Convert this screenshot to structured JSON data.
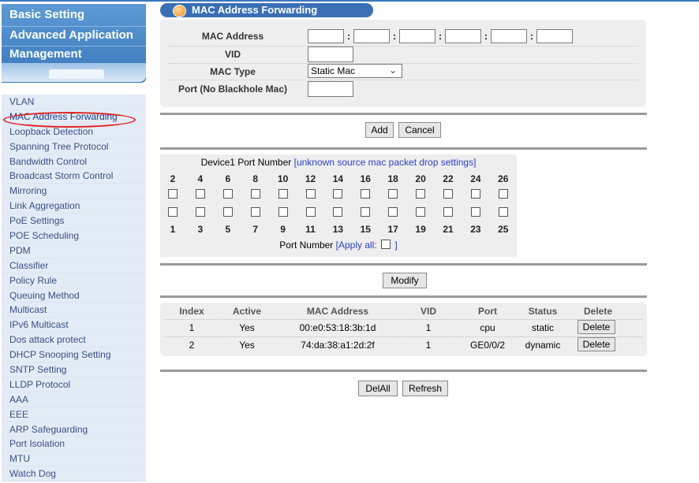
{
  "top_menu": [
    "Basic Setting",
    "Advanced Application",
    "Management"
  ],
  "nav_items": [
    "VLAN",
    "MAC Address Forwarding",
    "Loopback Detection",
    "Spanning Tree Protocol",
    "Bandwidth Control",
    "Broadcast Storm Control",
    "Mirroring",
    "Link Aggregation",
    "PoE Settings",
    "POE Scheduling",
    "PDM",
    "Classifier",
    "Policy Rule",
    "Queuing Method",
    "Multicast",
    "IPv6 Multicast",
    "Dos attack protect",
    "DHCP Snooping Setting",
    "SNTP Setting",
    "LLDP Protocol",
    "AAA",
    "EEE",
    "ARP Safeguarding",
    "Port Isolation",
    "MTU",
    "Watch Dog"
  ],
  "page_title": "MAC Address Forwarding",
  "form": {
    "mac_label": "MAC Address",
    "mac_separator": ":",
    "vid_label": "VID",
    "type_label": "MAC Type",
    "type_value": "Static Mac",
    "port_label": "Port (No Blackhole Mac)"
  },
  "buttons": {
    "add": "Add",
    "cancel": "Cancel",
    "modify": "Modify",
    "delall": "DelAll",
    "refresh": "Refresh"
  },
  "ports": {
    "title_prefix": "Device1 Port Number",
    "title_link": "[unknown source mac packet drop settings]",
    "even": [
      "2",
      "4",
      "6",
      "8",
      "10",
      "12",
      "14",
      "16",
      "18",
      "20",
      "22",
      "24",
      "26"
    ],
    "odd": [
      "1",
      "3",
      "5",
      "7",
      "9",
      "11",
      "13",
      "15",
      "17",
      "19",
      "21",
      "23",
      "25"
    ],
    "footer_label": "Port Number",
    "apply_all_open": "[Apply all:",
    "apply_all_close": "]"
  },
  "table": {
    "headers": [
      "Index",
      "Active",
      "MAC Address",
      "VID",
      "Port",
      "Status",
      "Delete"
    ],
    "rows": [
      [
        "1",
        "Yes",
        "00:e0:53:18:3b:1d",
        "1",
        "cpu",
        "static",
        "Delete"
      ],
      [
        "2",
        "Yes",
        "74:da:38:a1:2d:2f",
        "1",
        "GE0/0/2",
        "dynamic",
        "Delete"
      ]
    ]
  },
  "colors": {
    "nav_top": "#3b78bd",
    "title_pill": "#3a6fb6",
    "link_blue": "#2a3fcf",
    "highlight_oval": "#e2201c"
  }
}
